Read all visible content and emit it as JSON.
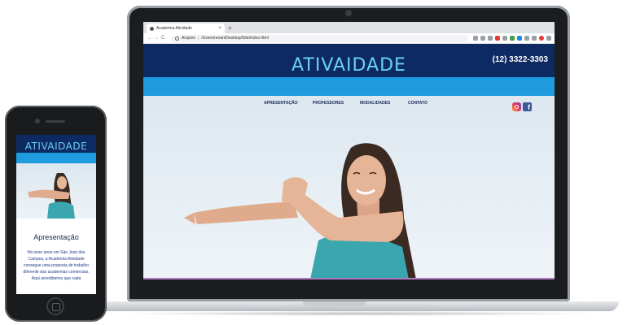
{
  "browser": {
    "tab_title": "Academia Atividade",
    "tab_close": "×",
    "new_tab": "+",
    "nav_back": "←",
    "nav_forward": "→",
    "nav_reload": "C",
    "address_label": "Arquivo",
    "address_path": "/Users/renan/Desktop/Site/index.html"
  },
  "site": {
    "logo": "ATIVAIDADE",
    "phone": "(12) 3322-3303",
    "nav": [
      "APRESENTAÇÃO",
      "PROFESSORES",
      "MODALIDADES",
      "CONTATO"
    ],
    "social": {
      "facebook_glyph": "f"
    }
  },
  "mobile": {
    "logo": "ATIVAIDADE",
    "section_title": "Apresentação",
    "paragraph": "Há onze anos em São José dos Campos, a Academia Atividade consegue uma proposta de trabalho diferente das academias comerciais. Aqui acreditamos que cada"
  },
  "colors": {
    "header_navy": "#0e2a63",
    "band_blue": "#1f9be0",
    "logo_cyan": "#6ad0f5",
    "nav_text": "#1b2b55",
    "top_bg": "#3fb0c0"
  }
}
